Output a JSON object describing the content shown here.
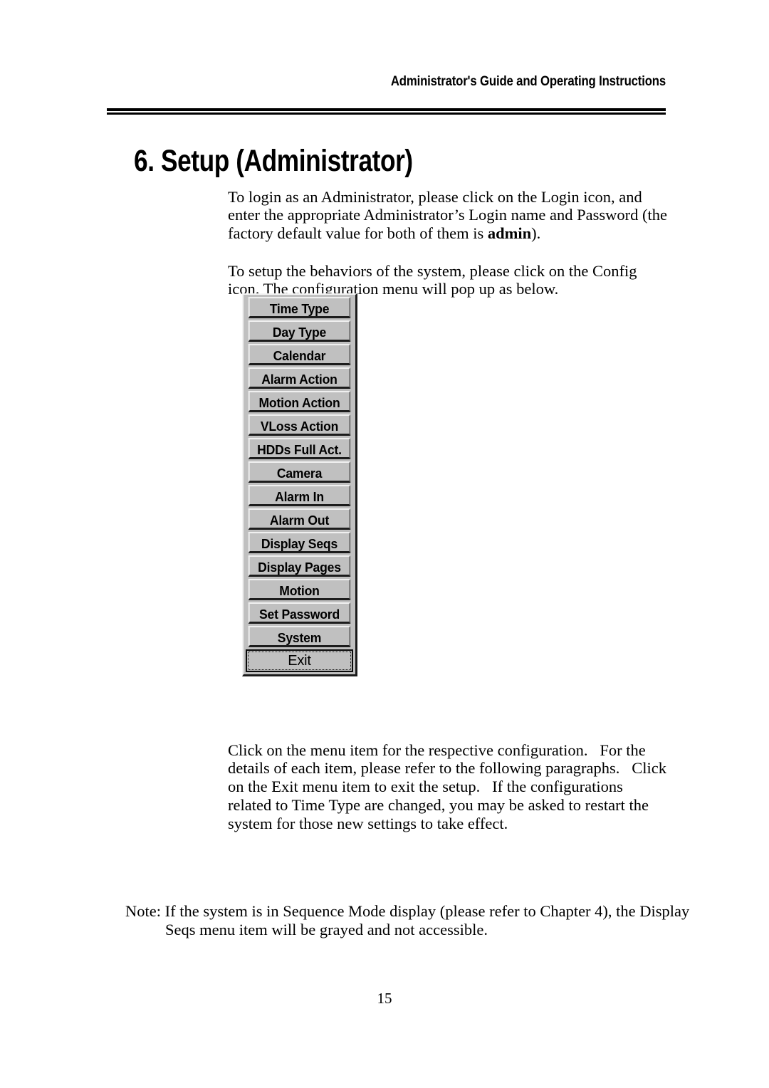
{
  "header": {
    "running_title": "Administrator's Guide and Operating Instructions"
  },
  "chapter": {
    "title": "6. Setup (Administrator)"
  },
  "body": {
    "para_login": "To login as an Administrator, please click on the Login icon, and enter the appropriate Administrator’s Login name and Password (the factory default value for both of them is ",
    "para_login_bold": "admin",
    "para_login_tail": ").",
    "para_setup": "To setup the behaviors of the system, please click on the Config icon. The configuration menu will pop up as below.",
    "para_click": "Click on the menu item for the respective configuration.   For the details of each item, please refer to the following paragraphs.   Click on the Exit menu item to exit the setup.   If the configurations related to Time Type are changed, you may be asked to restart the system for those new settings to take effect.",
    "note": "Note: If the system is in Sequence Mode display (please refer to Chapter 4), the Display Seqs menu item will be grayed and not accessible."
  },
  "config_menu": {
    "face_color": "#c0c0c0",
    "highlight_color": "#f0f0f0",
    "shadow_color": "#1c1c1c",
    "items": [
      {
        "label": "Time Type",
        "state": "normal"
      },
      {
        "label": "Day Type",
        "state": "normal"
      },
      {
        "label": "Calendar",
        "state": "normal"
      },
      {
        "label": "Alarm Action",
        "state": "normal"
      },
      {
        "label": "Motion Action",
        "state": "normal"
      },
      {
        "label": "VLoss Action",
        "state": "normal"
      },
      {
        "label": "HDDs Full Act.",
        "state": "normal"
      },
      {
        "label": "Camera",
        "state": "normal"
      },
      {
        "label": "Alarm In",
        "state": "normal"
      },
      {
        "label": "Alarm Out",
        "state": "normal"
      },
      {
        "label": "Display Seqs",
        "state": "normal"
      },
      {
        "label": "Display Pages",
        "state": "normal"
      },
      {
        "label": "Motion",
        "state": "normal"
      },
      {
        "label": "Set Password",
        "state": "normal"
      },
      {
        "label": "System",
        "state": "normal"
      },
      {
        "label": "Exit",
        "state": "focused-default"
      }
    ]
  },
  "footer": {
    "page_number": "15"
  }
}
